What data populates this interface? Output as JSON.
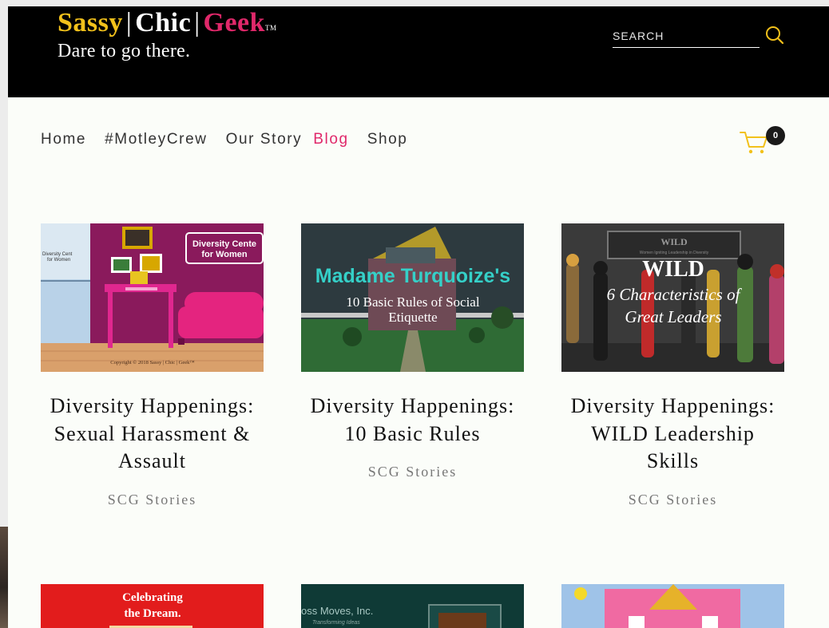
{
  "logo": {
    "sassy": "Sassy",
    "sep": "|",
    "chic": "Chic",
    "geek": "Geek",
    "tm": "TM",
    "tagline": "Dare to go there."
  },
  "search": {
    "placeholder": "SEARCH"
  },
  "nav": {
    "items": [
      {
        "label": "Home"
      },
      {
        "label": "#MotleyCrew"
      },
      {
        "label": "Our Story"
      },
      {
        "label": "Blog",
        "active": true
      },
      {
        "label": "Shop"
      }
    ]
  },
  "cart": {
    "count": "0"
  },
  "posts": [
    {
      "title": "Diversity Happenings: Sexual Harassment & Assault",
      "category": "SCG Stories",
      "image": {
        "sign": "Diversity Center for Women",
        "sign_left": "Diversity Cent... for Women",
        "copyright": "Copyright © 2018 Sassy | Chic | Geek™"
      }
    },
    {
      "title": "Diversity Happenings: 10 Basic Rules",
      "category": "SCG Stories",
      "image": {
        "headline": "Madame Turquoize's",
        "sub": "10 Basic Rules of Social Etiquette"
      }
    },
    {
      "title": "Diversity Happenings: WILD Leadership Skills",
      "category": "SCG Stories",
      "image": {
        "banner": "WILD",
        "banner_sub": "Women Igniting Leadership in Diversity",
        "headline": "WILD",
        "sub": "6 Characteristics of Great Leaders"
      }
    }
  ],
  "posts_row2": [
    {
      "image": {
        "text": "Celebrating the Dream."
      }
    },
    {
      "image": {
        "text": "oss Moves, Inc.",
        "sub": "Transforming Ideas"
      }
    },
    {
      "image": {}
    }
  ],
  "colors": {
    "yellow": "#f2c11b",
    "pink": "#e0286a",
    "header_bg": "#000000",
    "page_bg": "#fbfdf9"
  }
}
